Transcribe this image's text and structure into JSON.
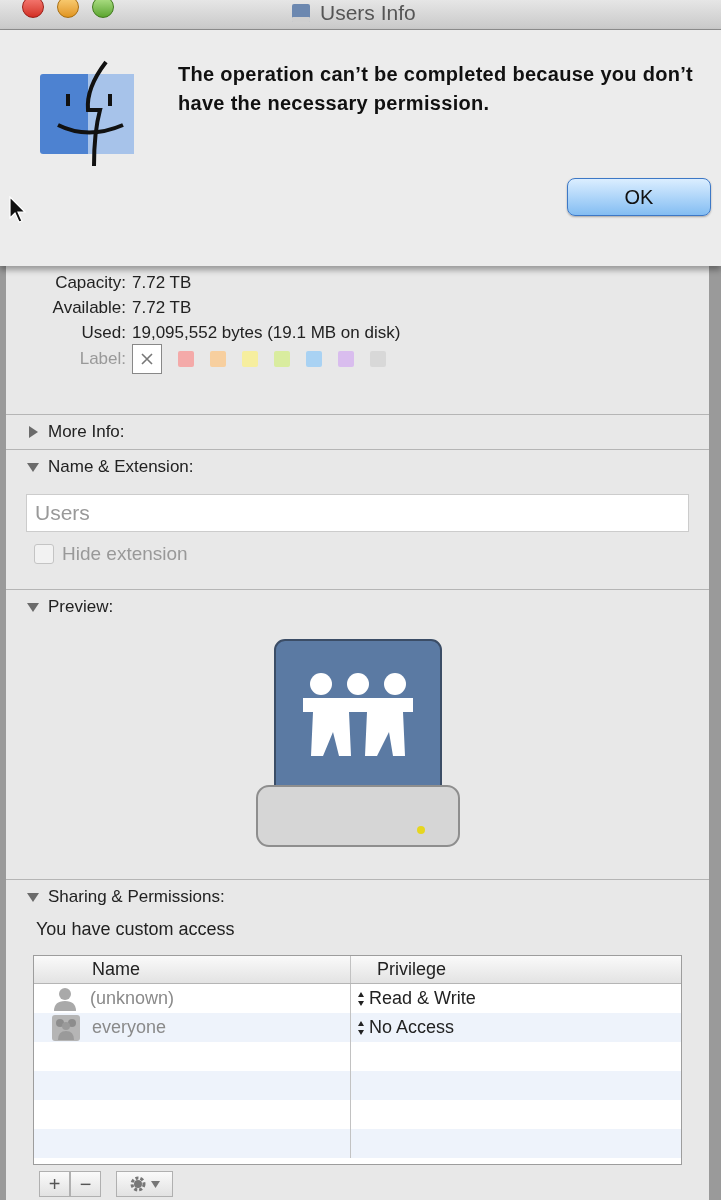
{
  "window": {
    "title": "Users Info"
  },
  "alert": {
    "message": "The operation can’t be completed because you don’t have the necessary permission.",
    "button": "OK"
  },
  "general": {
    "rows": [
      {
        "label": "Capacity:",
        "value": "7.72 TB"
      },
      {
        "label": "Available:",
        "value": "7.72 TB"
      },
      {
        "label": "Used:",
        "value": "19,095,552 bytes (19.1 MB on disk)"
      }
    ],
    "label_row": {
      "label": "Label:",
      "none_selected": true,
      "colors": [
        {
          "color": "#f4aaa9"
        },
        {
          "color": "#f7cf9f"
        },
        {
          "color": "#f6ee9f"
        },
        {
          "color": "#d9ec9f"
        },
        {
          "color": "#a9d2f3"
        },
        {
          "color": "#d9bdee"
        },
        {
          "color": "#d8d8d8"
        }
      ]
    }
  },
  "more_info": {
    "title": "More Info:",
    "expanded": false
  },
  "name_extension": {
    "title": "Name & Extension:",
    "expanded": true,
    "name_value": "Users",
    "disabled": true,
    "hide_extension": {
      "label": "Hide extension",
      "checked": false
    }
  },
  "preview": {
    "title": "Preview:",
    "expanded": true
  },
  "sharing": {
    "title": "Sharing & Permissions:",
    "expanded": true,
    "access_text": "You have custom access",
    "columns": [
      "Name",
      "Privilege"
    ],
    "rows": [
      {
        "kind": "user",
        "name": "(unknown)",
        "privilege": "Read & Write"
      },
      {
        "kind": "group",
        "name": "everyone",
        "privilege": "No Access"
      }
    ],
    "toolbar": [
      "+",
      "−"
    ]
  }
}
